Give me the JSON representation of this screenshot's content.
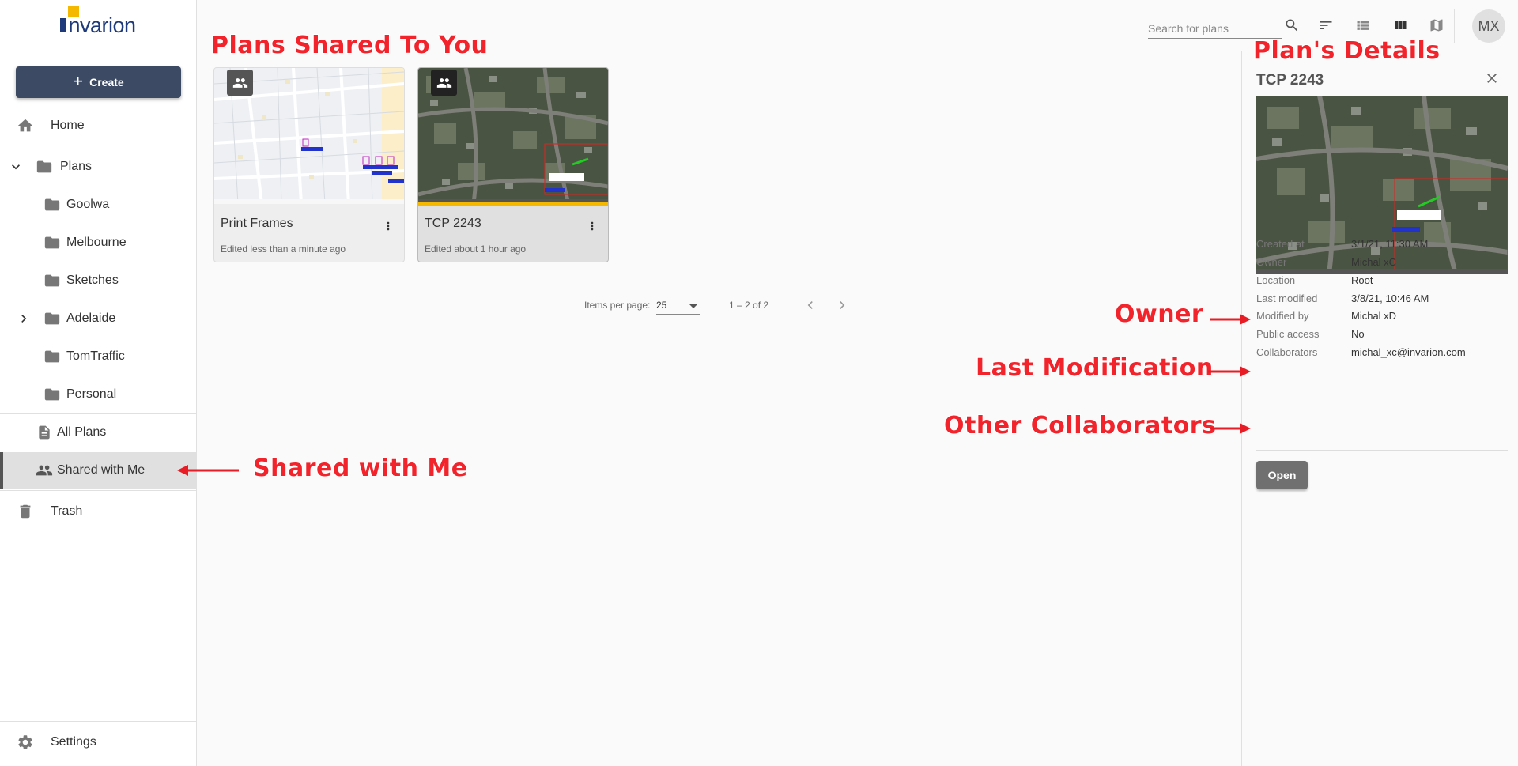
{
  "app": {
    "logo_text": "nvarion",
    "create_label": "Create"
  },
  "sidebar": {
    "items": [
      {
        "label": "Home",
        "icon": "home-icon"
      },
      {
        "label": "Plans",
        "icon": "folder-icon"
      },
      {
        "label": "Goolwa",
        "icon": "folder-icon"
      },
      {
        "label": "Melbourne",
        "icon": "folder-icon"
      },
      {
        "label": "Sketches",
        "icon": "folder-icon"
      },
      {
        "label": "Adelaide",
        "icon": "folder-icon"
      },
      {
        "label": "TomTraffic",
        "icon": "folder-icon"
      },
      {
        "label": "Personal",
        "icon": "folder-icon"
      },
      {
        "label": "All Plans",
        "icon": "document-icon"
      },
      {
        "label": "Shared with Me",
        "icon": "people-icon",
        "active": true
      },
      {
        "label": "Trash",
        "icon": "trash-icon"
      }
    ],
    "settings_label": "Settings"
  },
  "topbar": {
    "search_placeholder": "Search for plans",
    "avatar_initials": "MX"
  },
  "cards": [
    {
      "title": "Print Frames",
      "subtitle": "Edited less than a minute ago",
      "thumb": "street-map"
    },
    {
      "title": "TCP 2243",
      "subtitle": "Edited about 1 hour ago",
      "thumb": "satellite",
      "selected": true
    }
  ],
  "pager": {
    "items_per_page_label": "Items per page:",
    "items_per_page_value": "25",
    "range_label": "1 – 2 of 2"
  },
  "details": {
    "title": "TCP 2243",
    "rows": [
      {
        "key": "Created at",
        "value": "3/1/21, 11:30 AM"
      },
      {
        "key": "Owner",
        "value": "Michal xC"
      },
      {
        "key": "Location",
        "value": "Root"
      },
      {
        "key": "Last modified",
        "value": "3/8/21, 10:46 AM"
      },
      {
        "key": "Modified by",
        "value": "Michal xD"
      },
      {
        "key": "Public access",
        "value": "No"
      },
      {
        "key": "Collaborators",
        "value": "michal_xc@invarion.com"
      }
    ],
    "open_label": "Open"
  },
  "annotations": {
    "plans_shared": "Plans Shared To You",
    "plan_details": "Plan's Details",
    "owner": "Owner",
    "last_modification": "Last Modification",
    "other_collaborators": "Other Collaborators",
    "shared_with_me": "Shared with Me"
  },
  "colors": {
    "accent": "#3c4a63",
    "annotation": "#f2232b",
    "brand_yellow": "#f5b800",
    "brand_blue": "#1e3a7b"
  }
}
